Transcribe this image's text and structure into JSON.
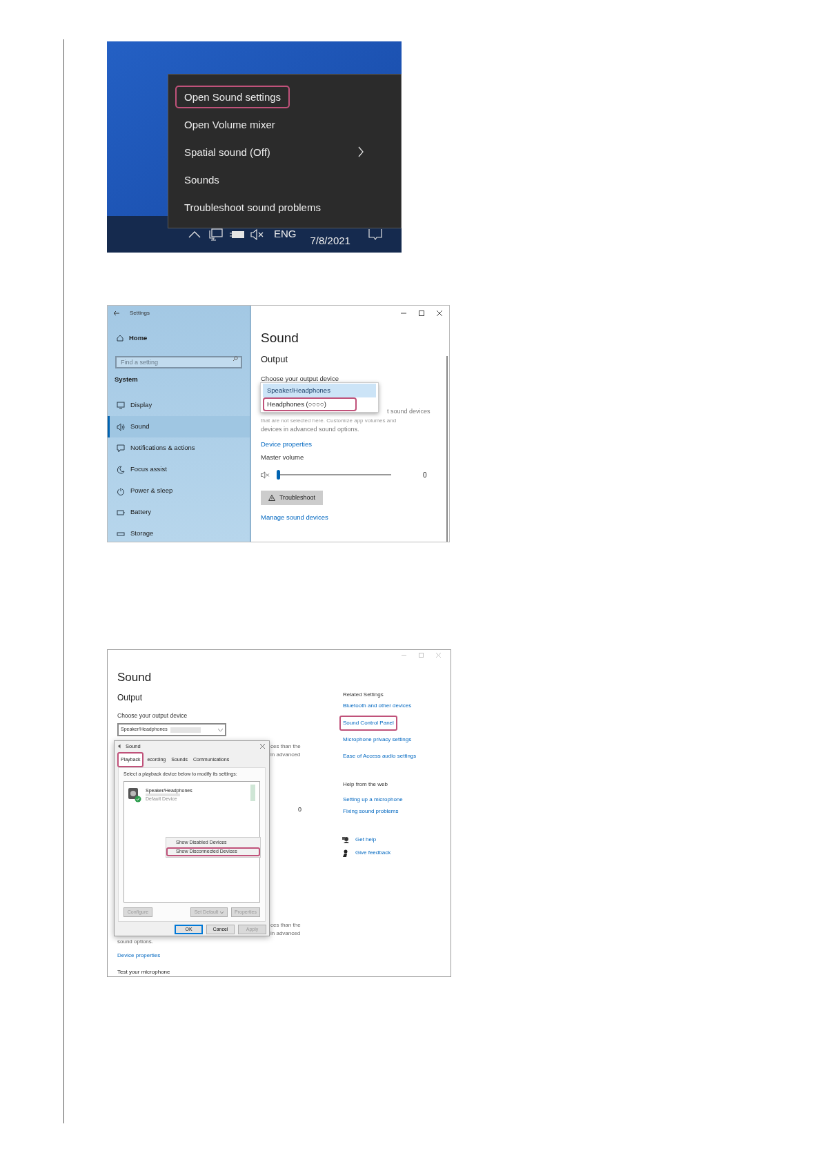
{
  "menu_screenshot": {
    "menu_items": [
      {
        "label": "Open Sound settings",
        "highlighted": true,
        "has_submenu": false
      },
      {
        "label": "Open Volume mixer",
        "highlighted": false,
        "has_submenu": false
      },
      {
        "label": "Spatial sound (Off)",
        "highlighted": false,
        "has_submenu": true
      },
      {
        "label": "Sounds",
        "highlighted": false,
        "has_submenu": false
      },
      {
        "label": "Troubleshoot sound problems",
        "highlighted": false,
        "has_submenu": false
      }
    ],
    "taskbar": {
      "language": "ENG",
      "date": "7/8/2021",
      "volume_muted": true
    }
  },
  "settings_screenshot": {
    "window_title": "Settings",
    "home": "Home",
    "search_placeholder": "Find a setting",
    "section": "System",
    "nav_items": [
      {
        "label": "Display",
        "selected": false
      },
      {
        "label": "Sound",
        "selected": true
      },
      {
        "label": "Notifications & actions",
        "selected": false
      },
      {
        "label": "Focus assist",
        "selected": false
      },
      {
        "label": "Power & sleep",
        "selected": false
      },
      {
        "label": "Battery",
        "selected": false
      },
      {
        "label": "Storage",
        "selected": false
      }
    ],
    "page_title": "Sound",
    "section_title": "Output",
    "device_label": "Choose your output device",
    "device_options": [
      {
        "label": "Speaker/Headphones",
        "selected": true,
        "highlighted": false
      },
      {
        "label": "Headphones (○○○○)",
        "selected": false,
        "highlighted": true
      }
    ],
    "hidden_text_lines": [
      "t sound devices",
      "that are not selected here. Customize app volumes and",
      "devices in advanced sound options."
    ],
    "device_properties_link": "Device properties",
    "master_volume_label": "Master volume",
    "volume": {
      "level": 0,
      "reading": "0",
      "muted": true
    },
    "troubleshoot_button": "Troubleshoot",
    "manage_link": "Manage sound devices"
  },
  "control_panel_screenshot": {
    "page_title": "Sound",
    "section_title": "Output",
    "device_label": "Choose your output device",
    "device_value": "Speaker/Headphones",
    "upper_fragments": [
      "ces than the",
      "in advanced"
    ],
    "volume_reading": "0",
    "lower_fragments": [
      "ces than the",
      "in advanced"
    ],
    "sound_options_text": "sound options.",
    "device_properties_link": "Device properties",
    "test_microphone": "Test your microphone",
    "related_title": "Related Settings",
    "related_links": [
      {
        "label": "Bluetooth and other devices",
        "highlighted": false
      },
      {
        "label": "Sound Control Panel",
        "highlighted": true
      },
      {
        "label": "Microphone privacy settings",
        "highlighted": false
      },
      {
        "label": "Ease of Access audio settings",
        "highlighted": false
      }
    ],
    "help_title": "Help from the web",
    "help_links": [
      "Setting up a microphone",
      "Fixing sound problems"
    ],
    "support_links": [
      "Get help",
      "Give feedback"
    ],
    "dialog": {
      "title": "Sound",
      "tabs": [
        {
          "label": "Playback",
          "selected": true,
          "highlighted": true
        },
        {
          "label": "ecording",
          "selected": false,
          "highlighted": false
        },
        {
          "label": "Sounds",
          "selected": false,
          "highlighted": false
        },
        {
          "label": "Communications",
          "selected": false,
          "highlighted": false
        }
      ],
      "instruction": "Select a playback device below to modify its settings:",
      "device": {
        "name": "Speaker/Headphones",
        "status": "Default Device"
      },
      "context_menu": [
        {
          "label": "Show Disabled Devices",
          "highlighted": false
        },
        {
          "label": "Show Disconnected Devices",
          "highlighted": true
        }
      ],
      "buttons": [
        {
          "label": "Configure",
          "disabled": true,
          "has_dropdown": false
        },
        {
          "label": "Set Default",
          "disabled": true,
          "has_dropdown": true
        },
        {
          "label": "Properties",
          "disabled": true,
          "has_dropdown": false
        }
      ],
      "footer_buttons": [
        {
          "label": "OK",
          "default": true,
          "disabled": false
        },
        {
          "label": "Cancel",
          "default": false,
          "disabled": false
        },
        {
          "label": "Apply",
          "default": false,
          "disabled": true
        }
      ]
    }
  }
}
